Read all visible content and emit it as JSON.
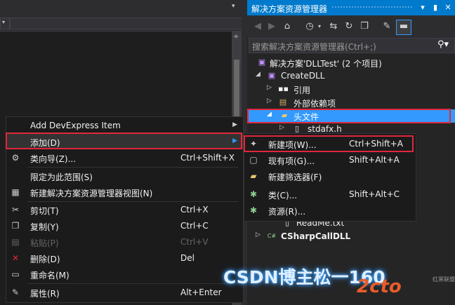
{
  "solution_explorer": {
    "title": "解决方案资源管理器",
    "title_buttons": [
      "▾",
      "▮",
      "✕"
    ],
    "search_placeholder": "搜索解决方案资源管理器(Ctrl+;)",
    "tree": [
      {
        "label": "解决方案'DLLTest' (2 个项目)"
      },
      {
        "label": "CreateDLL"
      },
      {
        "label": "引用"
      },
      {
        "label": "外部依赖项"
      },
      {
        "label": "头文件"
      },
      {
        "label": "stdafx.h"
      },
      {
        "label": "ReadMe.txt"
      },
      {
        "label": "CSharpCallDLL"
      }
    ]
  },
  "context_menu": {
    "items": [
      {
        "label": "Add DevExpress Item",
        "shortcut": ""
      },
      {
        "label": "添加(D)",
        "shortcut": ""
      },
      {
        "label": "类向导(Z)...",
        "shortcut": "Ctrl+Shift+X"
      },
      {
        "label": "限定为此范围(S)",
        "shortcut": ""
      },
      {
        "label": "新建解决方案资源管理器视图(N)",
        "shortcut": ""
      },
      {
        "label": "剪切(T)",
        "shortcut": "Ctrl+X"
      },
      {
        "label": "复制(Y)",
        "shortcut": "Ctrl+C"
      },
      {
        "label": "粘贴(P)",
        "shortcut": "Ctrl+V"
      },
      {
        "label": "删除(D)",
        "shortcut": "Del"
      },
      {
        "label": "重命名(M)",
        "shortcut": ""
      },
      {
        "label": "属性(R)",
        "shortcut": "Alt+Enter"
      }
    ]
  },
  "submenu": {
    "items": [
      {
        "label": "新建项(W)...",
        "shortcut": "Ctrl+Shift+A"
      },
      {
        "label": "现有项(G)...",
        "shortcut": "Shift+Alt+A"
      },
      {
        "label": "新建筛选器(F)",
        "shortcut": ""
      },
      {
        "label": "类(C)...",
        "shortcut": "Shift+Alt+C"
      },
      {
        "label": "资源(R)...",
        "shortcut": ""
      }
    ]
  },
  "watermark": {
    "text": "CSDN博主松一160",
    "logo": "2cto",
    "small": "红黑联盟"
  },
  "colors": {
    "accent": "#007acc",
    "selection": "#3399ff",
    "highlight_border": "#e0283a"
  }
}
